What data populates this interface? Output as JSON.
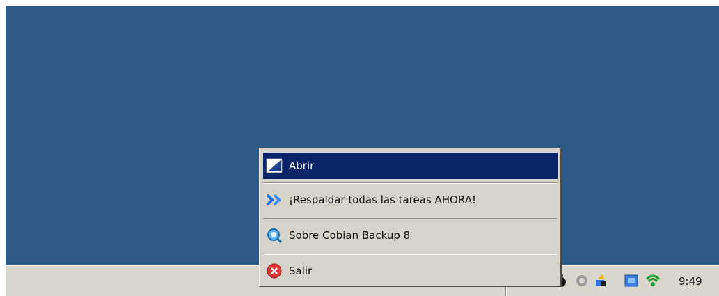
{
  "context_menu": {
    "items": [
      {
        "label": "Abrir",
        "icon": "open-window-icon",
        "selected": true
      },
      {
        "label": "¡Respaldar todas las tareas AHORA!",
        "icon": "double-arrow-icon",
        "selected": false
      },
      {
        "label": "Sobre Cobian Backup 8",
        "icon": "info-search-icon",
        "selected": false
      },
      {
        "label": "Salir",
        "icon": "close-icon",
        "selected": false
      }
    ]
  },
  "taskbar": {
    "clock": "9:49",
    "tray_icons": [
      "flag-icon",
      "cobian-tray-icon",
      "circle-icon",
      "shield-icon",
      "network-icon",
      "wireless-icon"
    ]
  },
  "colors": {
    "desktop": "#2d5a87",
    "selection": "#0a246a",
    "menu_bg": "#d6d3cb",
    "taskbar_bg": "#d9d6ce"
  }
}
